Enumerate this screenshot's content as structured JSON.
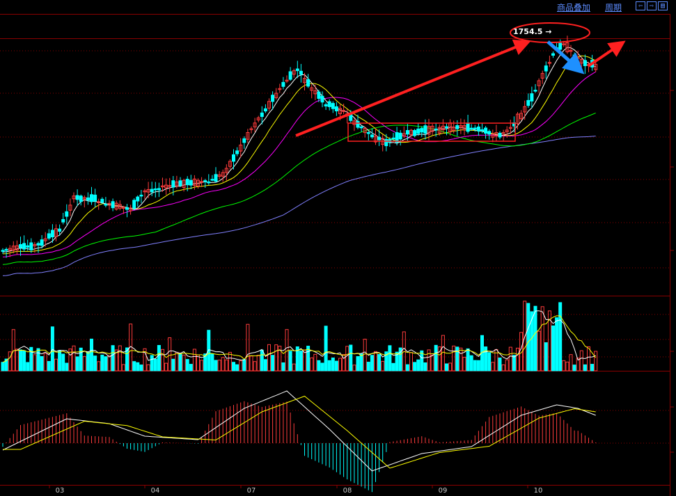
{
  "toolbar": {
    "overlay_label": "商品叠加",
    "period_label": "周期",
    "nav_icons": [
      "arrow-left-icon",
      "arrow-right-icon",
      "panel-toggle-icon"
    ]
  },
  "colors": {
    "background": "#000000",
    "grid": "#8a0000",
    "up": "#ff3c3c",
    "down": "#00ffff",
    "ma5": "#ffffff",
    "ma10": "#ffff00",
    "ma20": "#ff00ff",
    "ma60": "#00ff00",
    "ma120": "#8080ff",
    "annotation_red": "#ff2020",
    "annotation_blue": "#1e90ff"
  },
  "chart_data": {
    "type": "candlestick",
    "x_labels": [
      "03",
      "04",
      "07",
      "08",
      "09",
      "10"
    ],
    "annotation_price_label": "1754.5",
    "price_series_approx": [
      {
        "month": "03",
        "close": 1300
      },
      {
        "month": "04",
        "close": 1350
      },
      {
        "month": "07",
        "close": 1600
      },
      {
        "month": "08",
        "close": 1450
      },
      {
        "month": "09",
        "close": 1440
      },
      {
        "month": "10",
        "close": 1700
      }
    ],
    "peak_value": 1754.5,
    "panels": [
      "price",
      "volume",
      "macd"
    ],
    "moving_averages": [
      "MA5",
      "MA10",
      "MA20",
      "MA60",
      "MA120"
    ],
    "annotations": [
      "red-trend-arrow",
      "red-consolidation-box",
      "red-ellipse-peak",
      "blue-down-arrow",
      "red-up-arrow"
    ]
  }
}
